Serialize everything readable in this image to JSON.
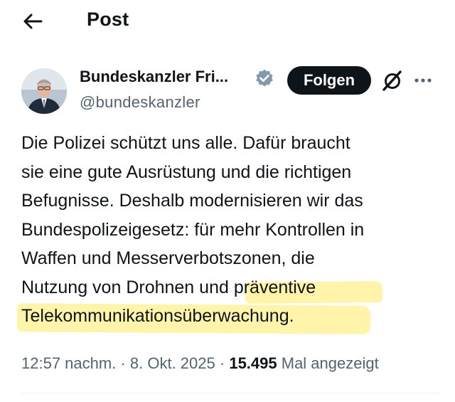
{
  "header": {
    "title": "Post",
    "back_icon": "arrow-left-icon"
  },
  "author": {
    "name": "Bundeskanzler Fri...",
    "handle": "@bundeskanzler",
    "verified_badge": "verified-badge-icon",
    "verified_color": "#829aab"
  },
  "actions": {
    "follow_label": "Folgen",
    "grok_icon": "grok-icon",
    "more_icon": "more-icon"
  },
  "tweet": {
    "lines": [
      "Die Polizei schützt uns alle. Dafür braucht",
      "sie eine gute Ausrüstung und die richtigen",
      "Befugnisse. Deshalb modernisieren wir das",
      "Bundespolizeigesetz: für mehr Kontrollen in",
      "Waffen und Messerverbotszonen, die",
      "Nutzung von Drohnen und präventive",
      "Telekommunikationsüberwachung."
    ],
    "highlight_color": "#fff29a"
  },
  "meta": {
    "time": "12:57 nachm.",
    "separator": "·",
    "date": "8. Okt. 2025",
    "views_count": "15.495",
    "views_label": "Mal angezeigt"
  }
}
